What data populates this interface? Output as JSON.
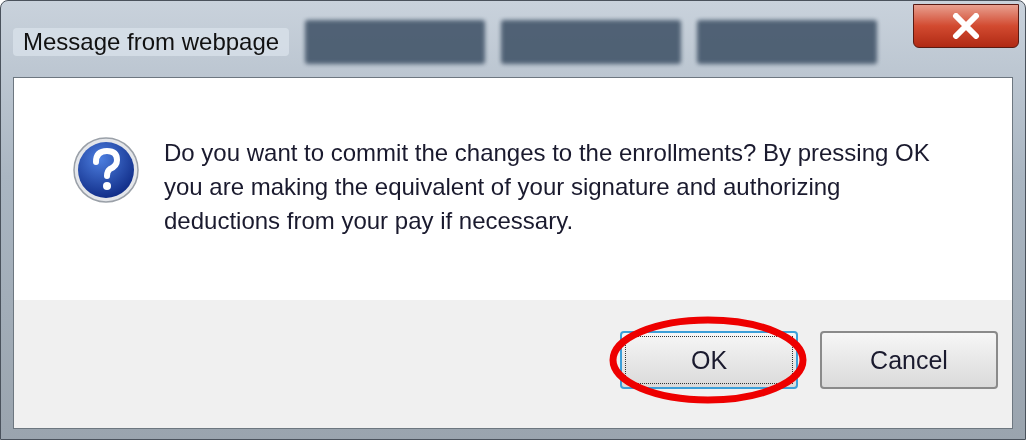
{
  "window": {
    "title": "Message from webpage"
  },
  "message": "Do you want to commit the changes to the enrollments?  By pressing OK you are making the equivalent of your signature and authorizing deductions from your pay if necessary.",
  "buttons": [
    {
      "label": "OK",
      "selected": true,
      "circled": true
    },
    {
      "label": "Cancel",
      "selected": false,
      "circled": false
    }
  ]
}
